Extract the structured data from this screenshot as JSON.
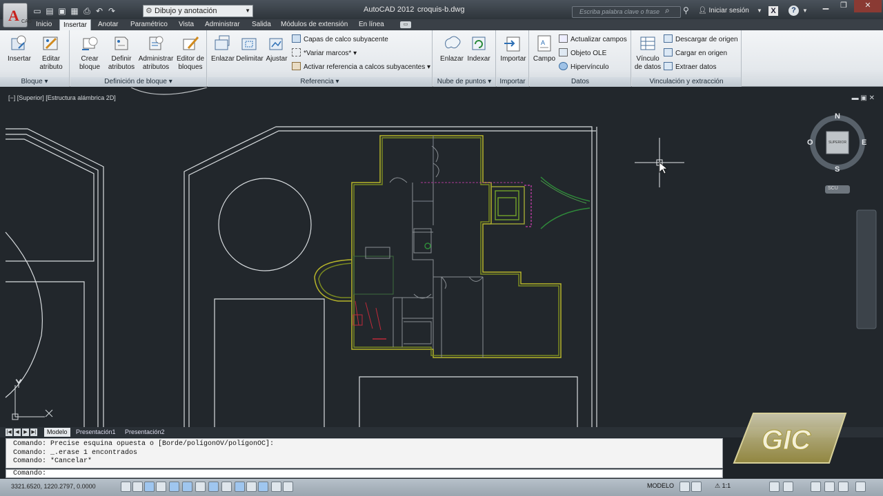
{
  "titlebar": {
    "app_name": "AutoCAD 2012",
    "file_name": "croquis-b.dwg",
    "workspace": "Dibujo y anotación",
    "search_placeholder": "Escriba palabra clave o frase",
    "login": "Iniciar sesión",
    "app_logo": "A",
    "app_logo_sub": "CAD",
    "exchange_label": "X",
    "help_label": "?",
    "quick_access_icons": [
      "new-icon",
      "open-icon",
      "save-icon",
      "save-as-icon",
      "plot-icon",
      "undo-icon",
      "redo-icon"
    ]
  },
  "menu_tabs": [
    "Inicio",
    "Insertar",
    "Anotar",
    "Paramétrico",
    "Vista",
    "Administrar",
    "Salida",
    "Módulos de extensión",
    "En línea"
  ],
  "active_tab": "Insertar",
  "ribbon": {
    "bloque": {
      "title": "Bloque",
      "insertar": "Insertar",
      "editar_1": "Editar",
      "editar_2": "atributo"
    },
    "definicion": {
      "title": "Definición de bloque",
      "crear_1": "Crear",
      "crear_2": "bloque",
      "definir_1": "Definir",
      "definir_2": "atributos",
      "admin_1": "Administrar",
      "admin_2": "atributos",
      "editor_1": "Editor de",
      "editor_2": "bloques"
    },
    "referencia": {
      "title": "Referencia",
      "enlazar": "Enlazar",
      "delimitar": "Delimitar",
      "ajustar": "Ajustar",
      "capas": "Capas de calco subyacente",
      "variar": "*Variar marcos*",
      "activar": "Activar referencia a calcos subyacentes"
    },
    "nube": {
      "title": "Nube de puntos",
      "enlazar": "Enlazar",
      "indexar": "Indexar"
    },
    "importar": {
      "title": "Importar",
      "importar": "Importar"
    },
    "datos": {
      "title": "Datos",
      "campo": "Campo",
      "actualizar": "Actualizar campos",
      "objeto_ole": "Objeto OLE",
      "hipervinculo": "Hipervínculo"
    },
    "vinculacion": {
      "title": "Vinculación y extracción",
      "vinculo_1": "Vínculo",
      "vinculo_2": "de datos",
      "descargar": "Descargar de origen",
      "cargar": "Cargar en origen",
      "extraer": "Extraer  datos"
    }
  },
  "viewport": {
    "label": "[−] [Superior] [Estructura alámbrica 2D]",
    "controls": "▬  ▣  ✕",
    "viewcube": {
      "n": "N",
      "s": "S",
      "e": "E",
      "o": "O",
      "face": "SUPERIOR",
      "ucs": "SCU"
    },
    "ucs_x": "X",
    "ucs_y": "Y"
  },
  "layout_tabs": [
    "Modelo",
    "Presentación1",
    "Presentación2"
  ],
  "command": {
    "history": [
      "Comando: Precise esquina opuesta o [Borde/polígonOV/polígonOC]:",
      "Comando: _.erase 1 encontrados",
      "Comando: *Cancelar*"
    ],
    "prompt": "Comando:"
  },
  "status": {
    "coords": "3321.6520, 1220.2797, 0.0000",
    "model": "MODELO",
    "scale": "1:1"
  },
  "watermark": {
    "logo": "GIC"
  },
  "colors": {
    "canvas": "#22272c",
    "ribbon": "#e8ecef",
    "titlebar": "#2f353b",
    "accent": "#2d6fb5"
  }
}
